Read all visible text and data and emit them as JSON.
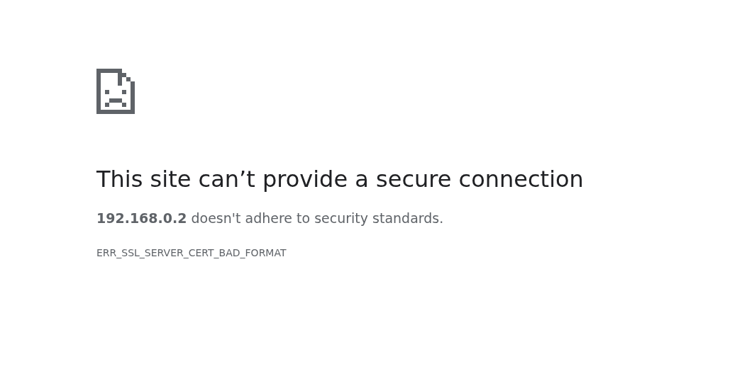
{
  "error_page": {
    "heading": "This site can’t provide a secure connection",
    "message": "**192.168.0.2** doesn't adhere to security standards.",
    "error_code": "ERR_SSL_SERVER_CERT_BAD_FORMAT"
  }
}
